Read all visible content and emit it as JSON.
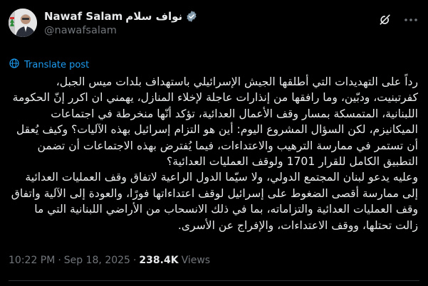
{
  "author": {
    "display_name": "Nawaf Salam",
    "display_name_ar": "نواف سلام",
    "handle": "@nawafsalam",
    "verified_badge_color": "#829aab"
  },
  "icons": {
    "avatar": "avatar-photo",
    "grok": "grok-icon",
    "more": "more-icon",
    "translate": "globe-icon",
    "verified": "verified-badge-icon"
  },
  "translate_label": "Translate post",
  "post_text": "رداً على التهديدات التي أطلقها الجيش الإسرائيلي باستهداف بلدات ميس الجبل، كفرتبنيت، ودبّين، وما رافقها من إنذارات عاجلة لإخلاء المنازل، يهمني ان اكرر إنّ الحكومة اللبنانية، المتمسكة بمسار وقف الأعمال العدائية، تؤكد أنّها منخرطة في اجتماعات الميكانيزم، لكن السؤال المشروع اليوم: أين هو التزام إسرائيل بهذه الآليات؟ وكيف يُعقل أن تستمر في ممارسة الترهيب والاعتداءات، فيما يُفترض بهذه الاجتماعات أن تضمن التطبيق الكامل للقرار 1701 ولوقف العمليات العدائية؟\nوعليه يدعو لبنان المجتمع الدولي، ولا سيّما الدول الراعية لاتفاق وقف العمليات العدائية إلى ممارسة أقصى الضغوط على إسرائيل لوقف اعتداءاتها فورًا، والعودة إلى الآلية واتفاق وقف العمليات العدائية والتزاماته، بما في ذلك الانسحاب من الأراضي اللبنانية التي ما زالت تحتلها، ووقف الاعتداءات، والإفراج عن الأسرى.",
  "meta": {
    "time": "10:22 PM",
    "separator": "·",
    "date": "Sep 18, 2025",
    "views_count": "238.4K",
    "views_label": "Views"
  },
  "colors": {
    "background": "#000000",
    "text": "#e7e9ea",
    "secondary": "#71767b",
    "link": "#1d9bf0"
  }
}
